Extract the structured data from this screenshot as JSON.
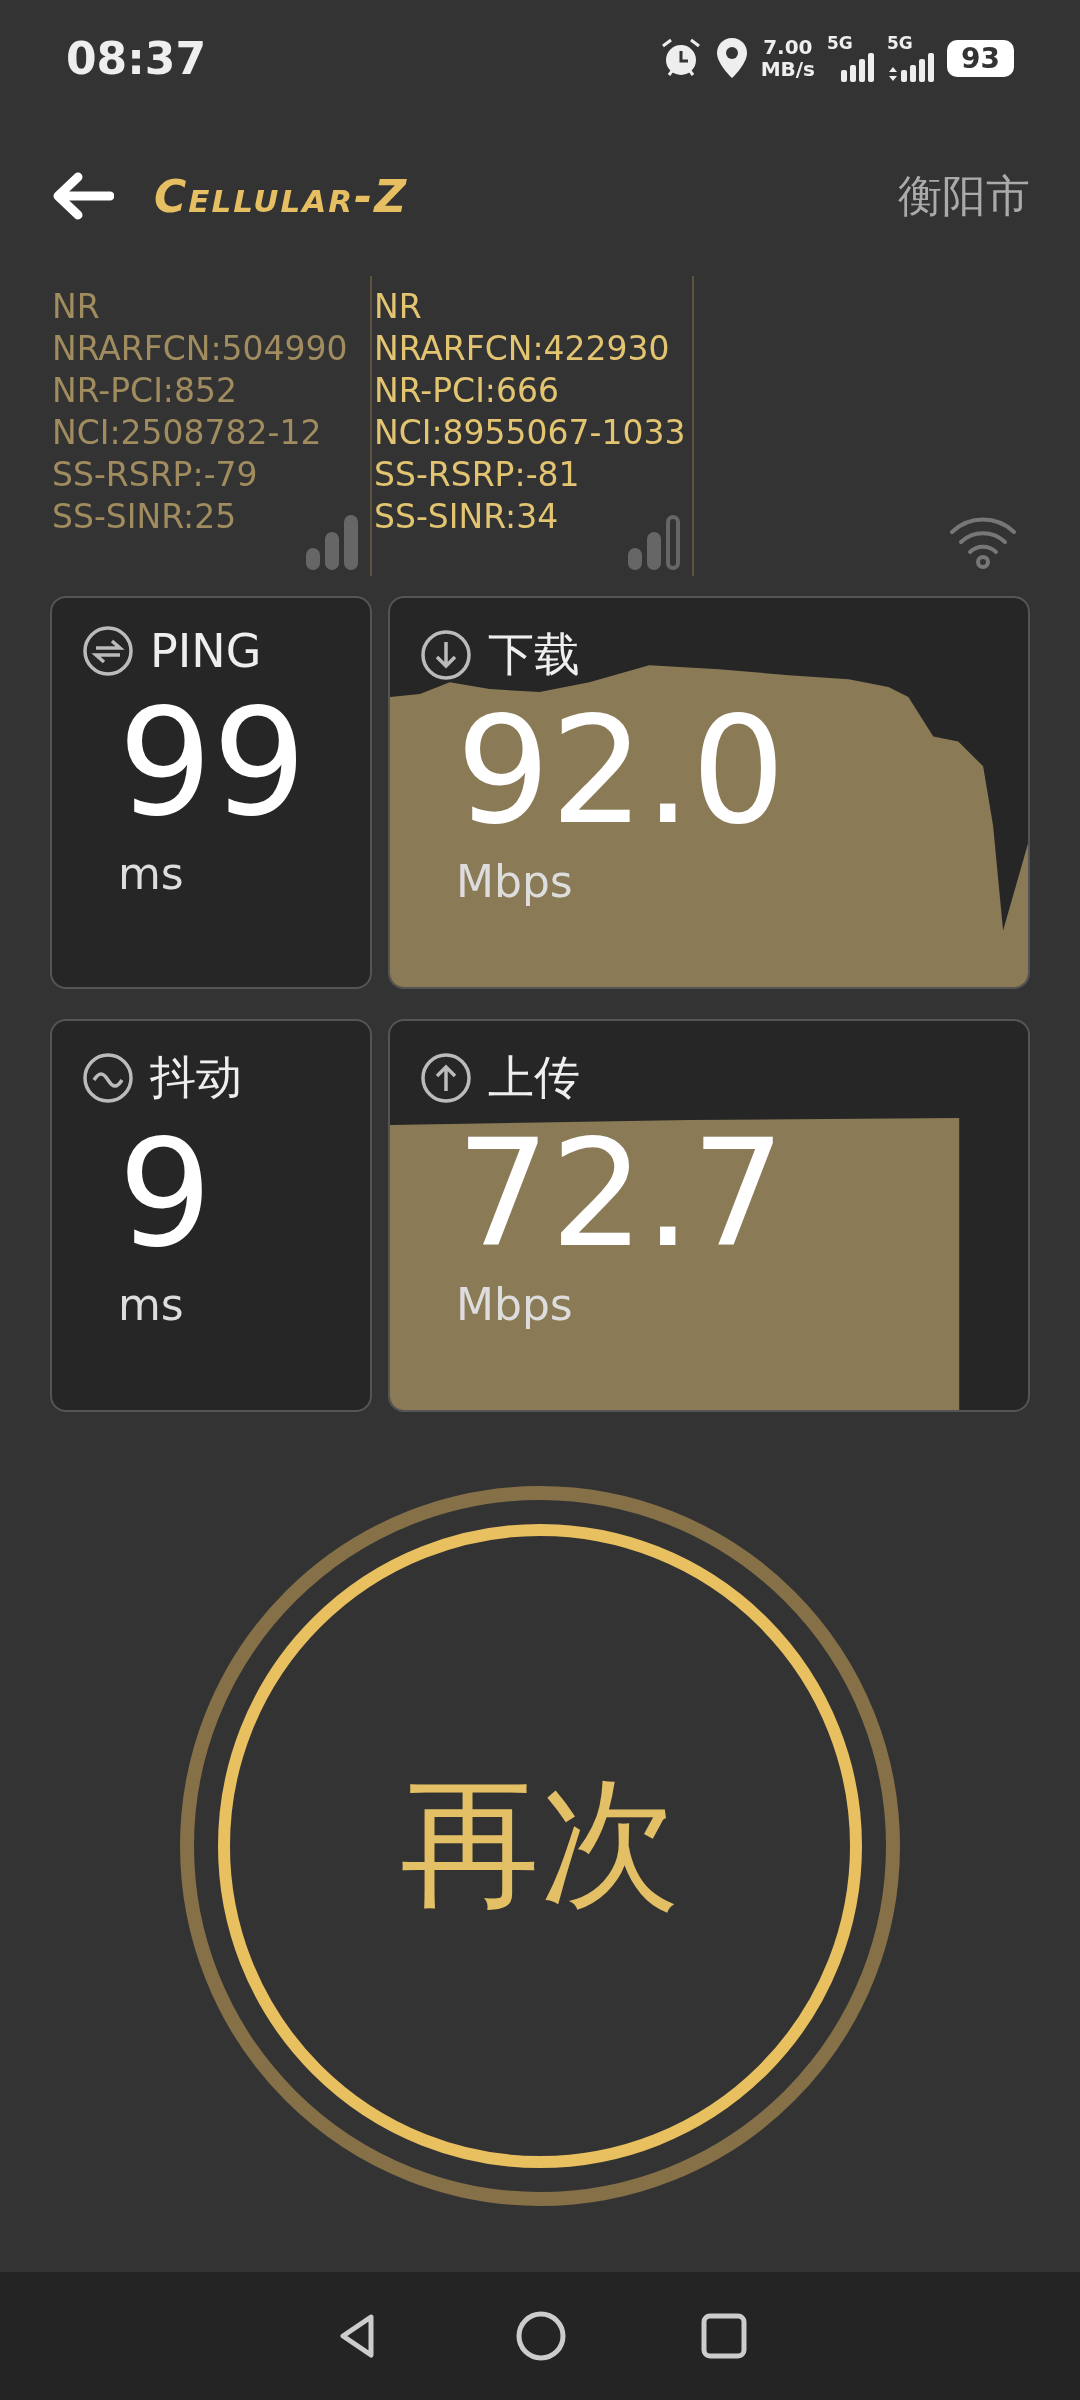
{
  "status_bar": {
    "time": "08:37",
    "net_speed": "7.00",
    "net_speed_unit": "MB/s",
    "sims": [
      "5G",
      "5G"
    ],
    "battery": "93"
  },
  "header": {
    "title": "Cellular-Z",
    "location": "衡阳市"
  },
  "cells": [
    {
      "active": false,
      "lines": [
        " NR",
        "NRARFCN:504990",
        "NR-PCI:852",
        "NCI:2508782-12",
        "SS-RSRP:-79",
        "SS-SINR:25"
      ]
    },
    {
      "active": true,
      "lines": [
        "NR",
        "NRARFCN:422930",
        "NR-PCI:666",
        "NCI:8955067-1033",
        "SS-RSRP:-81",
        "SS-SINR:34"
      ]
    }
  ],
  "metrics": [
    {
      "kind": "ping",
      "label": "PING",
      "value": "99",
      "unit": "ms"
    },
    {
      "kind": "download",
      "label": "下载",
      "value": "92.0",
      "unit": "Mbps"
    },
    {
      "kind": "jitter",
      "label": "抖动",
      "value": "9",
      "unit": "ms"
    },
    {
      "kind": "upload",
      "label": "上传",
      "value": "72.7",
      "unit": "Mbps"
    }
  ],
  "action_button": "再次"
}
